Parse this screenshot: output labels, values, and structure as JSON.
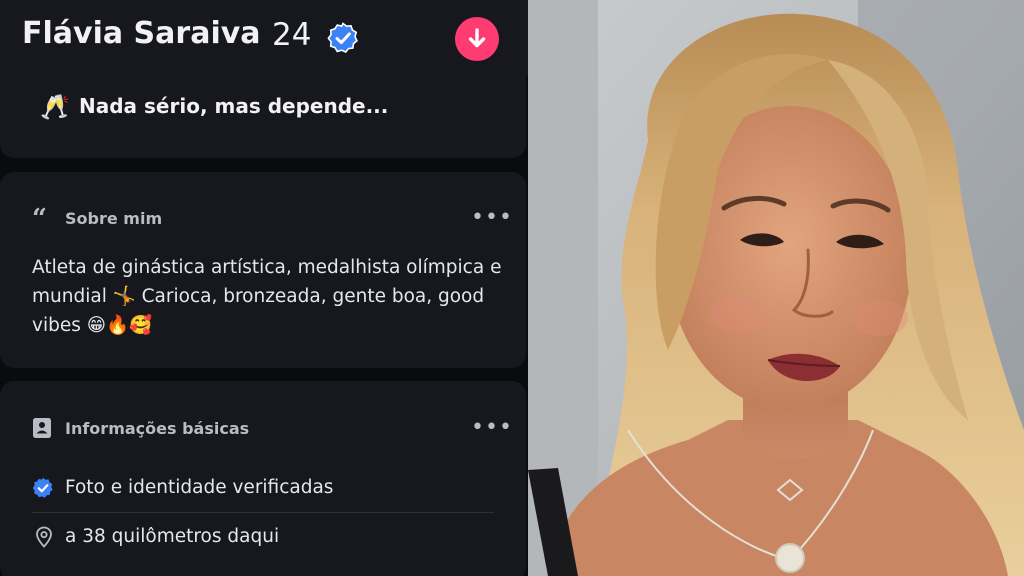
{
  "profile": {
    "name": "Flávia Saraiva",
    "age": "24",
    "relationship_intent": {
      "emoji": "🥂",
      "text": "Nada sério, mas depende..."
    }
  },
  "about": {
    "title": "Sobre mim",
    "bio": "Atleta de ginástica artística, medalhista olímpica e mundial 🤸 Carioca, bronzeada, gente boa, good vibes 😁🔥🥰"
  },
  "basic_info": {
    "title": "Informações básicas",
    "items": [
      {
        "icon": "verified-check-icon",
        "text": "Foto e identidade verificadas"
      },
      {
        "icon": "location-pin-icon",
        "text": "a 38 quilômetros daqui"
      }
    ]
  },
  "colors": {
    "accent": "#fe3c72",
    "verified": "#3b82f6",
    "card": "#16181e",
    "background": "#0a0b0f"
  }
}
